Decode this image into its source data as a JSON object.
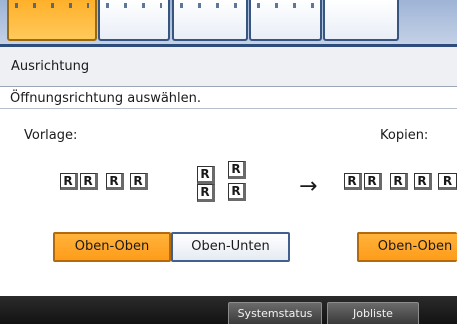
{
  "panel": {
    "title": "Ausrichtung",
    "instruction": "Öffnungsrichtung auswählen.",
    "original_label": "Vorlage:",
    "copies_label": "Kopien:",
    "r_glyph": "R",
    "arrow_icon": "→"
  },
  "buttons": {
    "top_top": "Oben-Oben",
    "top_bottom": "Oben-Unten",
    "copies_top_top": "Oben-Oben"
  },
  "footer": {
    "system_status": "Systemstatus",
    "job_list": "Jobliste"
  },
  "colors": {
    "selected": "#ff9c1a",
    "frame_blue": "#2d4c7b"
  }
}
